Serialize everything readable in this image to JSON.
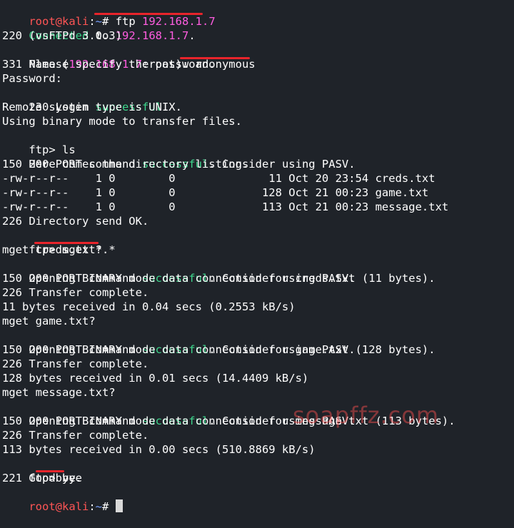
{
  "prompt": {
    "user": "root",
    "at": "@",
    "host": "kali",
    "sep": ":",
    "path": "~",
    "symbol": "# "
  },
  "ftp_prompt": "ftp> ",
  "host_ip": "192.168.1.7",
  "success_word": "successful",
  "commands": {
    "ftp": "ftp ",
    "user": "anonymous",
    "ls": "ls",
    "mget": "mget *.*",
    "bye": "bye"
  },
  "text": {
    "connected": "Connected",
    "connected_to": " to ",
    "connected_end": ".",
    "banner": "220 (vsFTPd 3.0.3)",
    "name_open": "Name (",
    "name_close": ":root): ",
    "pw_required": "331 Please specify the password.",
    "password": "Password:",
    "login_pre": "230 Login ",
    "login_post": ".",
    "remote_system": "Remote system type is UNIX.",
    "binary_mode": "Using binary mode to transfer files.",
    "port_pre": "200 PORT command ",
    "port_post": ". Consider using PASV.",
    "dir_listing": "150 Here comes the directory listing.",
    "dir_ok": "226 Directory send OK.",
    "goodbye": "221 Goodbye."
  },
  "listing": [
    "-rw-r--r--    1 0        0              11 Oct 20 23:54 creds.txt",
    "-rw-r--r--    1 0        0             128 Oct 21 00:23 game.txt",
    "-rw-r--r--    1 0        0             113 Oct 21 00:23 message.txt"
  ],
  "transfers": [
    {
      "query": "mget creds.txt?",
      "opening": "150 Opening BINARY mode data connection for creds.txt (11 bytes).",
      "complete": "226 Transfer complete.",
      "stats": "11 bytes received in 0.04 secs (0.2553 kB/s)"
    },
    {
      "query": "mget game.txt?",
      "opening": "150 Opening BINARY mode data connection for game.txt (128 bytes).",
      "complete": "226 Transfer complete.",
      "stats": "128 bytes received in 0.01 secs (14.4409 kB/s)"
    },
    {
      "query": "mget message.txt?",
      "opening": "150 Opening BINARY mode data connection for message.txt (113 bytes).",
      "complete": "226 Transfer complete.",
      "stats": "113 bytes received in 0.00 secs (510.8869 kB/s)"
    }
  ],
  "watermark": "soapffz.com",
  "colors": {
    "background": "#1f2329",
    "prompt_user": "#ff5555",
    "prompt_path": "#7aa2ff",
    "ip": "#ff5de0",
    "success": "#3dd68c",
    "underline": "#e8242b"
  }
}
